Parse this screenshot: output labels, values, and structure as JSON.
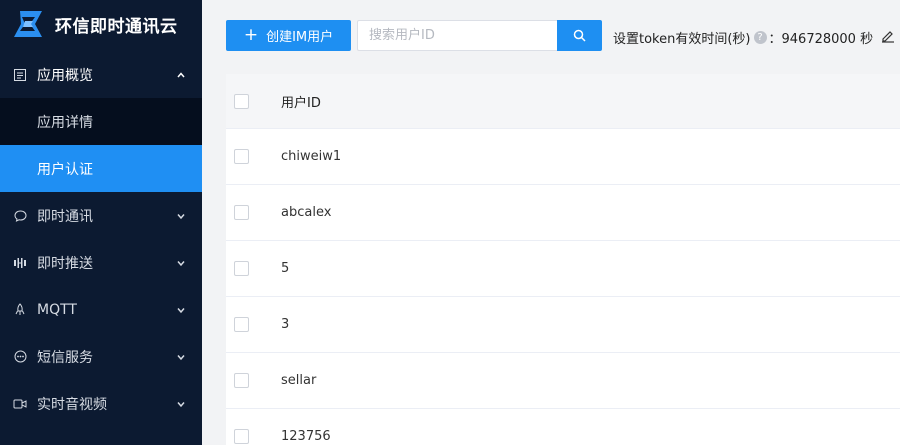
{
  "brand": {
    "title": "环信即时通讯云"
  },
  "sidebar": {
    "items": [
      {
        "label": "应用概览",
        "icon": "app-overview-icon",
        "expanded": true
      },
      {
        "label": "应用详情",
        "sub": true
      },
      {
        "label": "用户认证",
        "sub": true,
        "active": true
      },
      {
        "label": "即时通讯",
        "icon": "chat-icon"
      },
      {
        "label": "即时推送",
        "icon": "push-icon"
      },
      {
        "label": "MQTT",
        "icon": "mqtt-icon"
      },
      {
        "label": "短信服务",
        "icon": "sms-icon"
      },
      {
        "label": "实时音视频",
        "icon": "video-icon"
      }
    ]
  },
  "toolbar": {
    "create_label": "创建IM用户",
    "search_placeholder": "搜索用户ID",
    "token_label": "设置token有效时间(秒)",
    "token_sep": "：",
    "token_value": "946728000 秒"
  },
  "table": {
    "header": "用户ID",
    "rows": [
      "chiweiw1",
      "abcalex",
      "5",
      "3",
      "sellar",
      "123756"
    ]
  },
  "colors": {
    "sidebar_bg": "#0c1a31",
    "accent": "#1f8ff3"
  }
}
